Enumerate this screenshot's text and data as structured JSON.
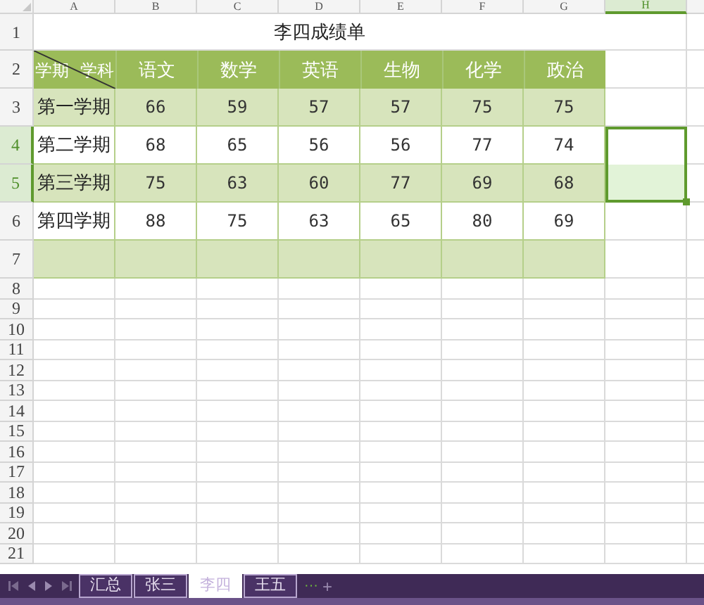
{
  "column_headers": [
    {
      "label": "A",
      "selected": false
    },
    {
      "label": "B",
      "selected": false
    },
    {
      "label": "C",
      "selected": false
    },
    {
      "label": "D",
      "selected": false
    },
    {
      "label": "E",
      "selected": false
    },
    {
      "label": "F",
      "selected": false
    },
    {
      "label": "G",
      "selected": false
    },
    {
      "label": "H",
      "selected": true
    }
  ],
  "row_numbers": [
    {
      "label": "1",
      "selected": false
    },
    {
      "label": "2",
      "selected": false
    },
    {
      "label": "3",
      "selected": false
    },
    {
      "label": "4",
      "selected": true
    },
    {
      "label": "5",
      "selected": true
    },
    {
      "label": "6",
      "selected": false
    },
    {
      "label": "7",
      "selected": false
    },
    {
      "label": "8",
      "selected": false
    },
    {
      "label": "9",
      "selected": false
    },
    {
      "label": "10",
      "selected": false
    },
    {
      "label": "11",
      "selected": false
    },
    {
      "label": "12",
      "selected": false
    },
    {
      "label": "13",
      "selected": false
    },
    {
      "label": "14",
      "selected": false
    },
    {
      "label": "15",
      "selected": false
    },
    {
      "label": "16",
      "selected": false
    },
    {
      "label": "17",
      "selected": false
    },
    {
      "label": "18",
      "selected": false
    },
    {
      "label": "19",
      "selected": false
    },
    {
      "label": "20",
      "selected": false
    },
    {
      "label": "21",
      "selected": false
    }
  ],
  "table": {
    "title": "李四成绩单",
    "corner": {
      "row_label": "学期",
      "column_label": "学科"
    },
    "columns": [
      "语文",
      "数学",
      "英语",
      "生物",
      "化学",
      "政治"
    ],
    "rows": [
      {
        "term": "第一学期",
        "cells": [
          "66",
          "59",
          "57",
          "57",
          "75",
          "75"
        ]
      },
      {
        "term": "第二学期",
        "cells": [
          "68",
          "65",
          "56",
          "56",
          "77",
          "74"
        ]
      },
      {
        "term": "第三学期",
        "cells": [
          "75",
          "63",
          "60",
          "77",
          "69",
          "68"
        ]
      },
      {
        "term": "第四学期",
        "cells": [
          "88",
          "75",
          "63",
          "65",
          "80",
          "69"
        ]
      }
    ]
  },
  "sheet_tabs": [
    {
      "label": "汇总",
      "selected": false
    },
    {
      "label": "张三",
      "selected": false
    },
    {
      "label": "李四",
      "selected": true
    },
    {
      "label": "王五",
      "selected": false
    }
  ],
  "more_tabs": "···",
  "add_tab": "+"
}
